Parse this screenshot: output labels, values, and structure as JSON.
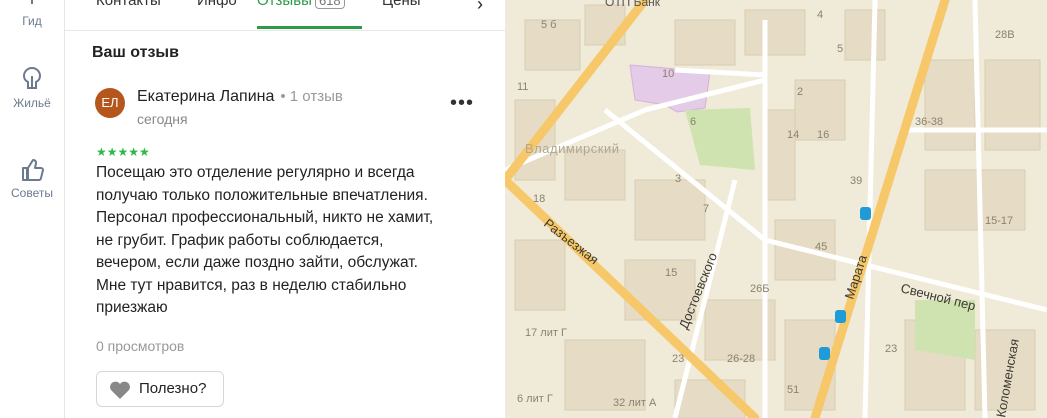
{
  "sidebar": {
    "items": [
      {
        "label": "Гид",
        "icon": "guide-icon"
      },
      {
        "label": "Жильё",
        "icon": "housing-icon"
      },
      {
        "label": "Советы",
        "icon": "thumbs-up-icon"
      }
    ]
  },
  "tabs": [
    {
      "label": "Контакты"
    },
    {
      "label": "Инфо"
    },
    {
      "label": "Отзывы",
      "count": "618",
      "active": true
    },
    {
      "label": "Цены"
    }
  ],
  "review_section": {
    "title": "Ваш отзыв",
    "author": {
      "initials": "ЕЛ",
      "name": "Екатерина Лапина",
      "reviews": "1 отзыв",
      "date": "сегодня"
    },
    "rating": 5,
    "stars": "★★★★★",
    "text": "Посещаю это отделение регулярно и всегда\nполучаю только положительные впечатления.\nПерсонал профессиональный, никто не хамит,\nне грубит. График работы соблюдается,\nвечером, если даже поздно зайти, обслужат.\nМне тут нравится, раз в неделю стабильно\nприезжаю",
    "views": "0 просмотров",
    "useful_label": "Полезно?",
    "more_icon": "more-dots-icon"
  },
  "map": {
    "labels": {
      "bank": "ОТП Банк",
      "district": "Владимирский",
      "street_razezzhaya": "Разъезжая",
      "street_dostoevskogo": "Достоевского",
      "street_marata": "Марата",
      "street_svechnoy": "Свечной пер",
      "street_kolomenskaya": "Коломенская",
      "n_5b": "5 б",
      "n_4": "4",
      "n_5": "5",
      "n_11_top": "11",
      "n_28v": "28В",
      "n_10": "10",
      "n_6": "6",
      "n_2": "2",
      "n_14": "14",
      "n_16": "16",
      "n_36_38": "36-38",
      "n_18": "18",
      "n_39": "39",
      "n_7": "7",
      "n_3": "3",
      "n_15_17": "15-17",
      "n_45": "45",
      "n_15": "15",
      "n_26b": "26Б",
      "n_17litg": "17 лит Г",
      "n_23a": "23",
      "n_26_28": "26-28",
      "n_23b": "23",
      "n_51": "51",
      "n_6litg": "6 лит Г",
      "n_32litg": "32 лит А"
    },
    "colors": {
      "background": "#f0ead8",
      "major_road": "#f7c86a",
      "building": "#e6dcc6",
      "park": "#cfe3b0",
      "highlight": "#e4cbe8",
      "metro": "#1f9bd7"
    }
  }
}
